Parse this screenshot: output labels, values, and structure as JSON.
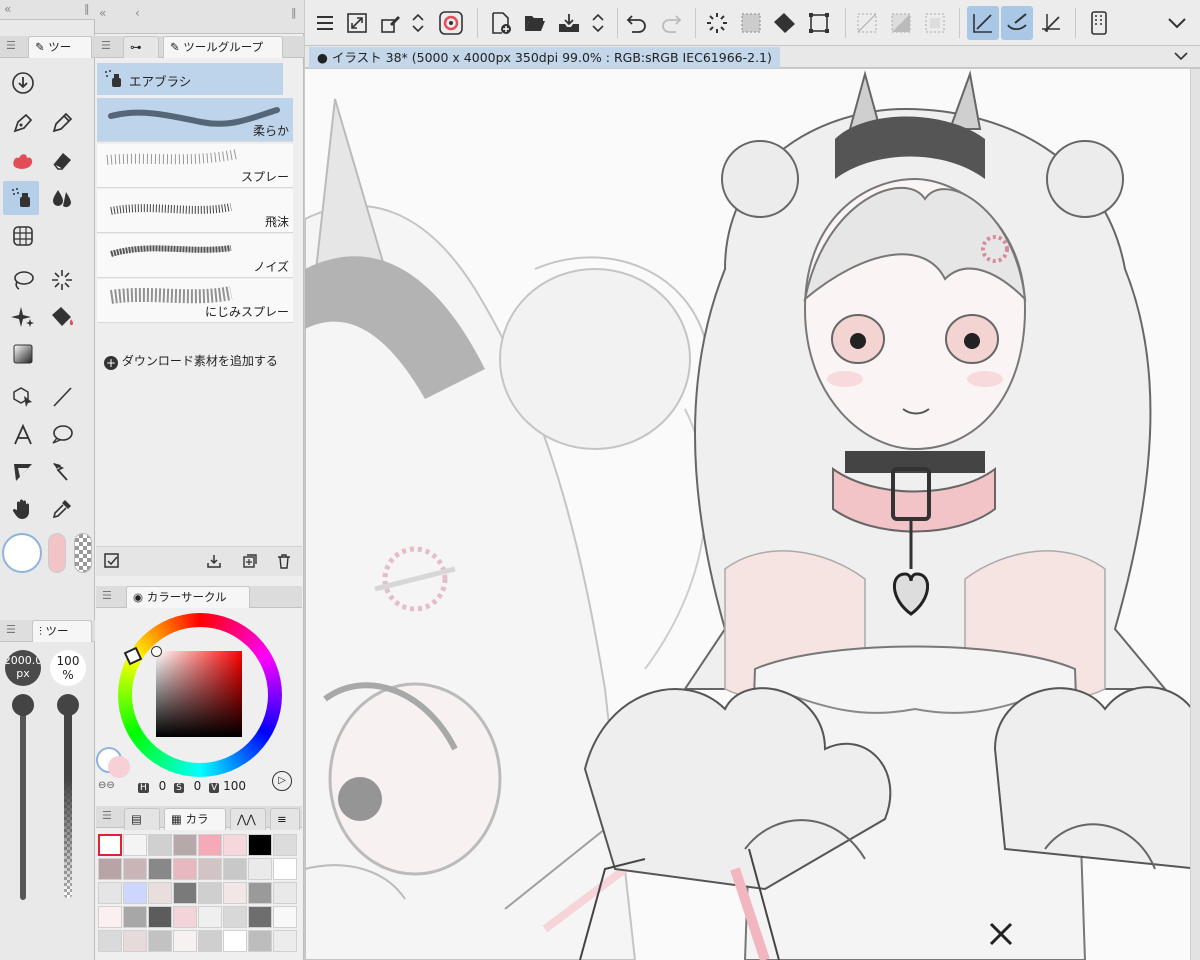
{
  "document_tab": {
    "title": "イラスト 38* (5000 x 4000px 350dpi 99.0% : RGB:sRGB IEC61966-2.1)"
  },
  "tool_panel": {
    "tab_label": "ツー",
    "selected_tool": "airbrush"
  },
  "subtool_panel": {
    "tab_label": "ツールグループ",
    "group_name": "エアブラシ",
    "brushes": [
      "柔らか",
      "スプレー",
      "飛沫",
      "ノイズ",
      "にじみスプレー"
    ],
    "selected_brush": "柔らか",
    "add_download_label": "ダウンロード素材を追加する"
  },
  "tool_property": {
    "tab_label": "ツー",
    "brush_size": "2000.0",
    "brush_size_unit": "px",
    "opacity": "100",
    "opacity_unit": "%"
  },
  "color_panel": {
    "tab_label": "カラーサークル",
    "h_label": "H",
    "h_value": "0",
    "s_label": "S",
    "s_value": "0",
    "v_label": "V",
    "v_value": "100"
  },
  "color_set_panel": {
    "tab_label": "カラ"
  },
  "colors": {
    "accent_selected": "#b5cfe8",
    "toolbar_bg": "#ececec",
    "canvas_bg": "#fafafa",
    "pink_accent": "#f2c4c8"
  }
}
